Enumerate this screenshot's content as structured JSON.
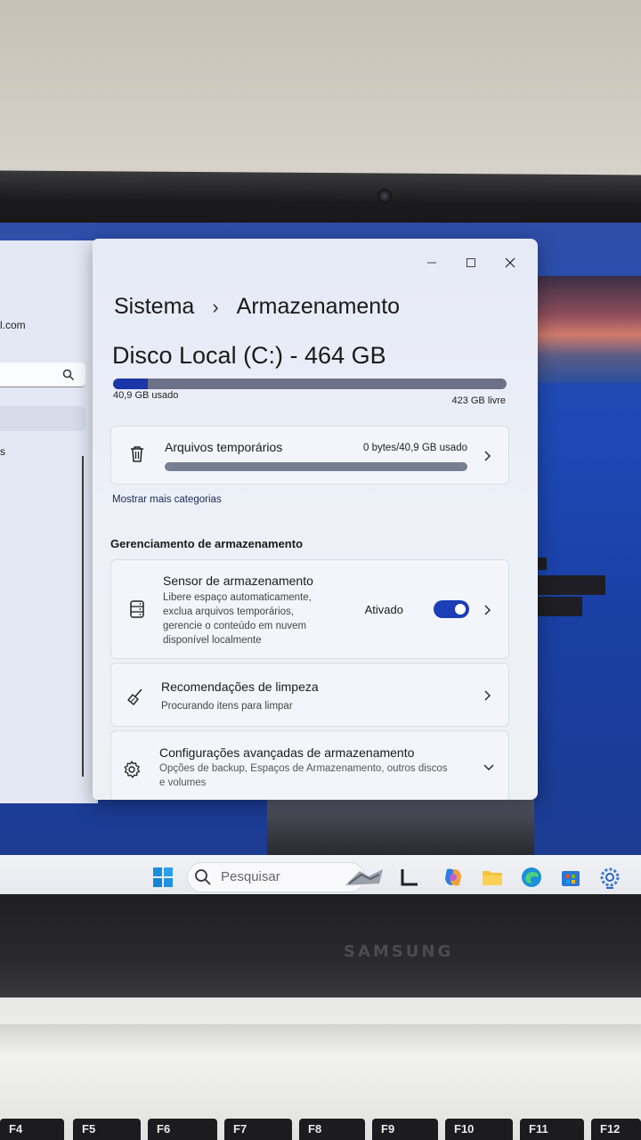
{
  "left_panel": {
    "email_fragment": "l.com",
    "search_icon": "search-icon",
    "item_fragment": "s"
  },
  "window": {
    "controls": {
      "minimize": "—",
      "maximize": "☐",
      "close": "✕"
    },
    "breadcrumb": {
      "parent": "Sistema",
      "separator": "›",
      "current": "Armazenamento"
    },
    "disk": {
      "title": "Disco Local (C:) - 464 GB",
      "used_label": "40,9 GB usado",
      "free_label": "423 GB livre",
      "used_fraction": 0.088
    },
    "temp_card": {
      "icon": "trash-icon",
      "title": "Arquivos temporários",
      "value": "0 bytes/40,9 GB usado",
      "bar_fraction": 0.0
    },
    "more_categories_link": "Mostrar mais categorias",
    "management_heading": "Gerenciamento de armazenamento",
    "sensor_card": {
      "icon": "storage-sense-icon",
      "title": "Sensor de armazenamento",
      "description": [
        "Libere espaço automaticamente,",
        "exclua arquivos temporários,",
        "gerencie o conteúdo em nuvem",
        "disponível localmente"
      ],
      "state_label": "Ativado",
      "enabled": true
    },
    "cleanup_card": {
      "icon": "broom-icon",
      "title": "Recomendações de limpeza",
      "subtitle": "Procurando itens para limpar"
    },
    "advanced_card": {
      "icon": "gear-icon",
      "title": "Configurações avançadas de armazenamento",
      "subtitle_lines": [
        "Opções de backup, Espaços de Armazenamento, outros discos",
        "e volumes"
      ]
    }
  },
  "taskbar": {
    "search_placeholder": "Pesquisar",
    "icons": [
      "start-icon",
      "search-icon",
      "widgets-icon",
      "task-view-icon",
      "copilot-icon",
      "file-explorer-icon",
      "edge-icon",
      "store-icon",
      "settings-icon"
    ]
  },
  "hardware": {
    "brand": "SAMSUNG",
    "keys": [
      "F4",
      "F5",
      "F6",
      "F7",
      "F8",
      "F9",
      "F10",
      "F11",
      "F12"
    ]
  },
  "colors": {
    "accent": "#1c3fb8",
    "usage_fill": "#1a36a8",
    "desktop": "#1e49b6"
  }
}
